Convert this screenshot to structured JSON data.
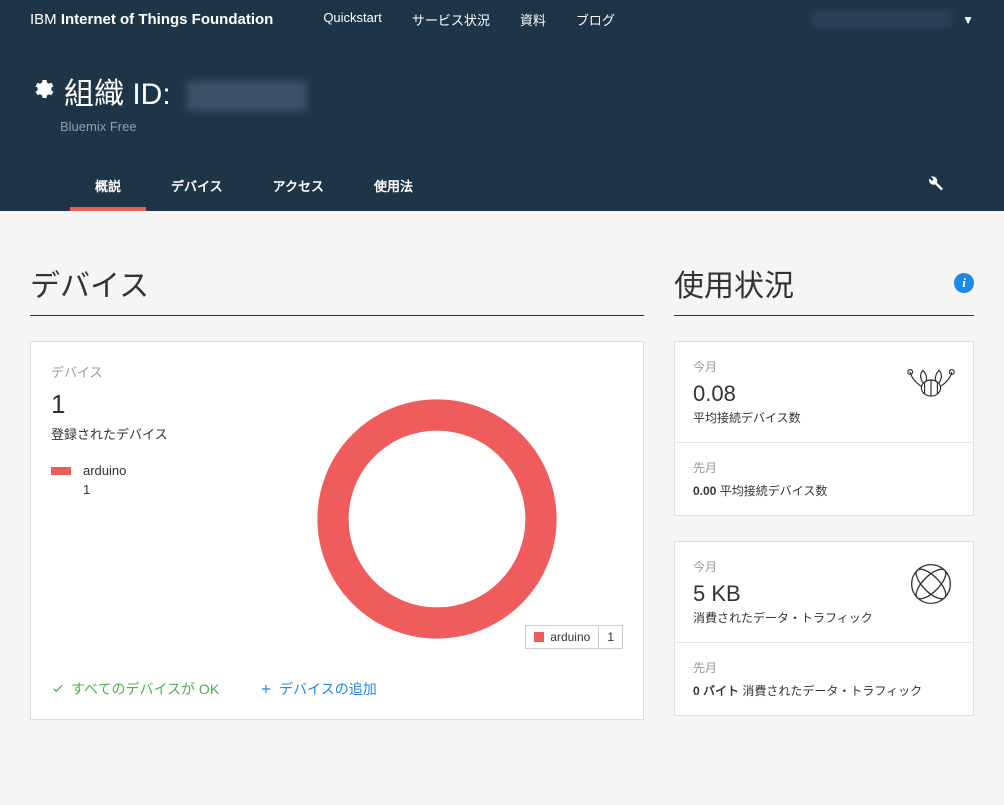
{
  "brand": {
    "ibm": "IBM",
    "iot": "Internet of Things Foundation"
  },
  "nav": {
    "quickstart": "Quickstart",
    "service_status": "サービス状況",
    "docs": "資料",
    "blog": "ブログ"
  },
  "user_caret": "▼",
  "org": {
    "label": "組織 ID:",
    "plan": "Bluemix Free"
  },
  "tabs": {
    "overview": "概説",
    "devices": "デバイス",
    "access": "アクセス",
    "usage": "使用法"
  },
  "sections": {
    "devices_title": "デバイス",
    "usage_title": "使用状況"
  },
  "device_card": {
    "label": "デバイス",
    "count": "1",
    "registered": "登録されたデバイス",
    "legend_name": "arduino",
    "legend_count": "1",
    "chart_legend_name": "arduino",
    "chart_legend_count": "1",
    "status_ok": "すべてのデバイスが OK",
    "add_device": "デバイスの追加"
  },
  "usage_devices": {
    "this_month_label": "今月",
    "value": "0.08",
    "desc": "平均接続デバイス数",
    "last_month_label": "先月",
    "prev_value": "0.00",
    "prev_desc": "平均接続デバイス数"
  },
  "usage_traffic": {
    "this_month_label": "今月",
    "value": "5 KB",
    "desc": "消費されたデータ・トラフィック",
    "last_month_label": "先月",
    "prev_value": "0 バイト",
    "prev_desc": "消費されたデータ・トラフィック"
  },
  "chart_data": {
    "type": "pie",
    "title": "デバイス",
    "categories": [
      "arduino"
    ],
    "values": [
      1
    ],
    "colors": [
      "#ef5c5c"
    ]
  }
}
